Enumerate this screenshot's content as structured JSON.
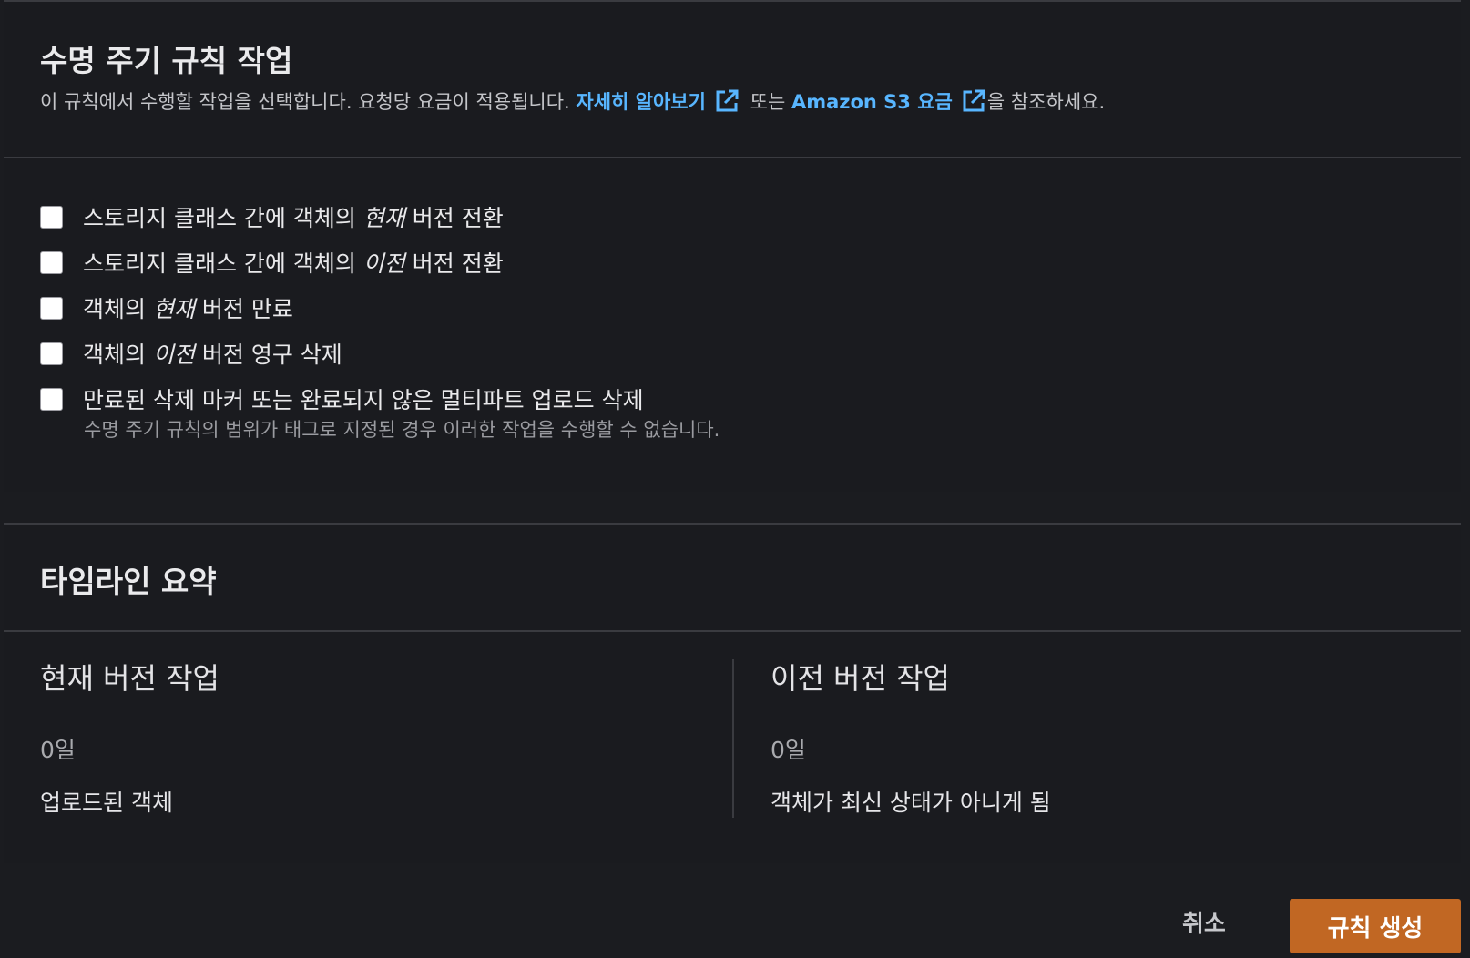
{
  "lifecycle_actions": {
    "title": "수명 주기 규칙 작업",
    "description_prefix": "이 규칙에서 수행할 작업을 선택합니다. 요청당 요금이 적용됩니다. ",
    "learn_more_link": "자세히 알아보기",
    "description_or": " 또는 ",
    "pricing_link": "Amazon S3 요금",
    "description_suffix": "을 참조하세요.",
    "options": [
      {
        "pre": "스토리지 클래스 간에 객체의 ",
        "em": "현재",
        "post": " 버전 전환",
        "checked": false
      },
      {
        "pre": "스토리지 클래스 간에 객체의 ",
        "em": "이전",
        "post": " 버전 전환",
        "checked": false
      },
      {
        "pre": "객체의 ",
        "em": "현재",
        "post": " 버전 만료",
        "checked": false
      },
      {
        "pre": "객체의 ",
        "em": "이전",
        "post": " 버전 영구 삭제",
        "checked": false
      },
      {
        "pre": "만료된 삭제 마커 또는 완료되지 않은 멀티파트 업로드 삭제",
        "em": "",
        "post": "",
        "checked": false
      }
    ],
    "option_hint": "수명 주기 규칙의 범위가 태그로 지정된 경우 이러한 작업을 수행할 수 없습니다."
  },
  "timeline": {
    "title": "타임라인 요약",
    "current": {
      "title": "현재 버전 작업",
      "days": "0일",
      "event": "업로드된 객체"
    },
    "previous": {
      "title": "이전 버전 작업",
      "days": "0일",
      "event": "객체가 최신 상태가 아니게 됨"
    }
  },
  "footer": {
    "cancel_label": "취소",
    "create_label": "규칙 생성"
  },
  "colors": {
    "link": "#58b6ff",
    "primary_button": "#c16723",
    "background": "#1a1b1f"
  }
}
